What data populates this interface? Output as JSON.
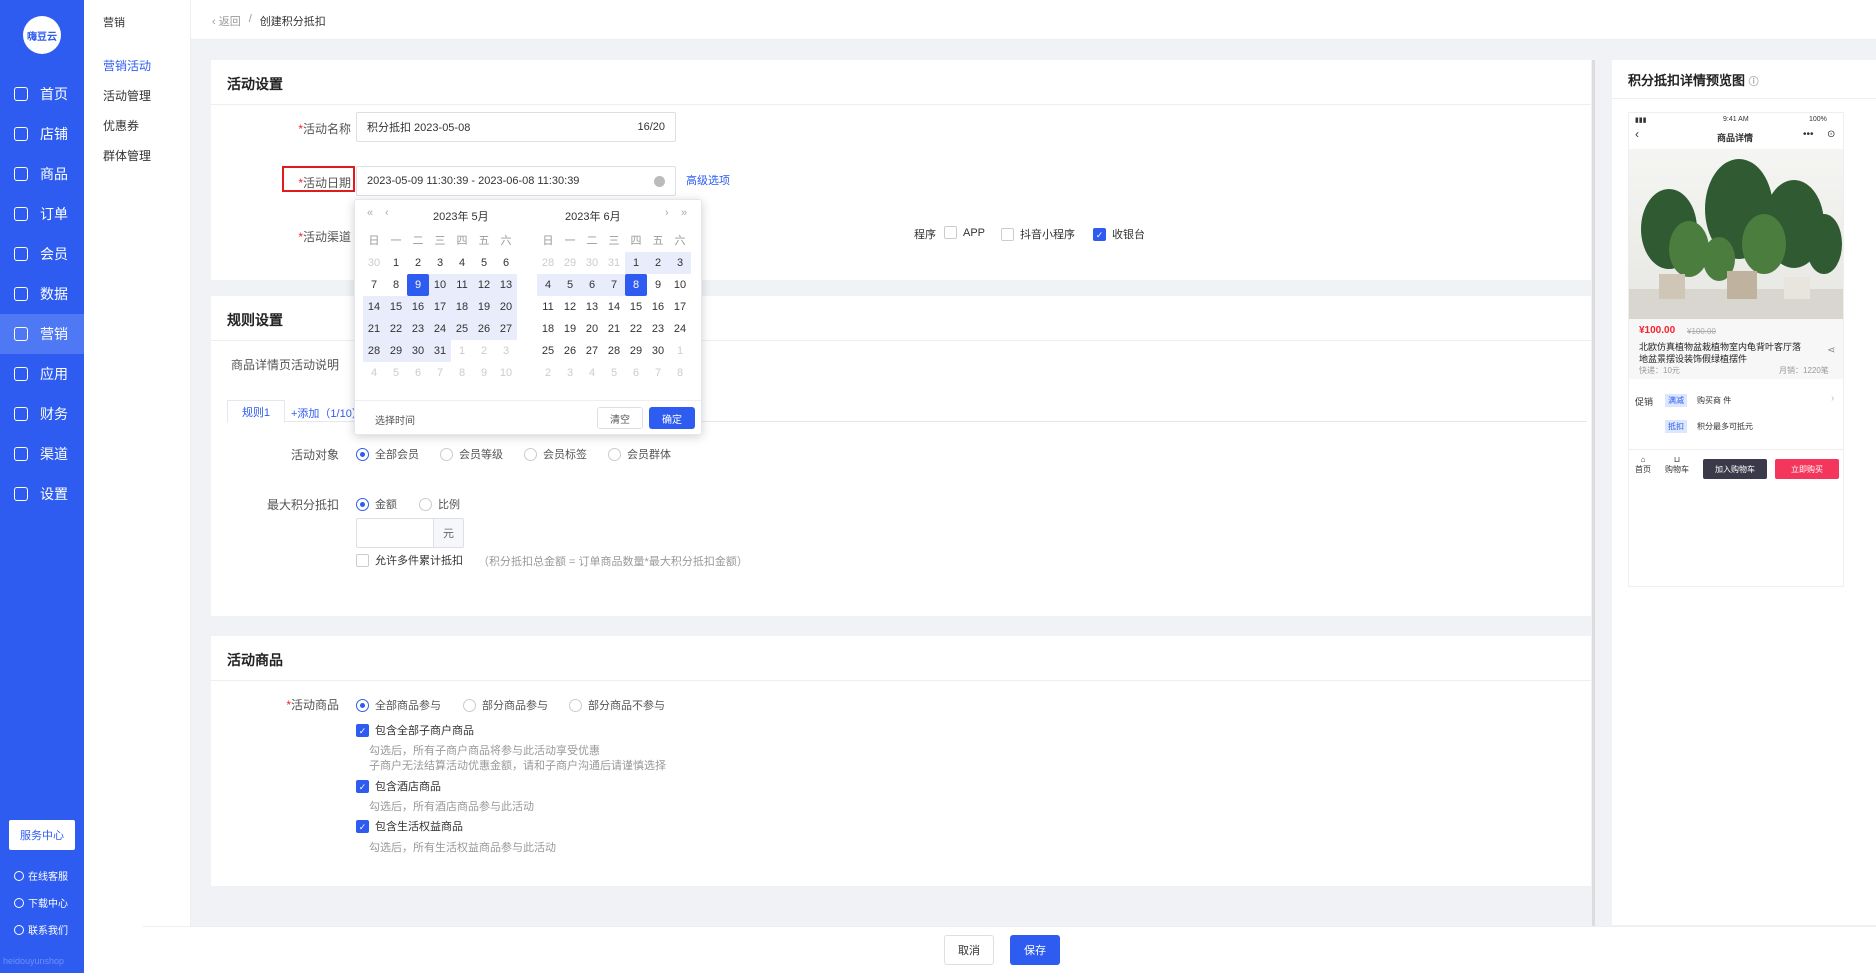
{
  "nav": {
    "logo": "嗨豆云",
    "items": [
      {
        "label": "首页",
        "icon": "home-icon"
      },
      {
        "label": "店铺",
        "icon": "store-icon"
      },
      {
        "label": "商品",
        "icon": "goods-icon"
      },
      {
        "label": "订单",
        "icon": "order-icon"
      },
      {
        "label": "会员",
        "icon": "member-icon"
      },
      {
        "label": "数据",
        "icon": "data-icon"
      },
      {
        "label": "营销",
        "icon": "tag-icon"
      },
      {
        "label": "应用",
        "icon": "app-icon"
      },
      {
        "label": "财务",
        "icon": "finance-icon"
      },
      {
        "label": "渠道",
        "icon": "channel-icon"
      },
      {
        "label": "设置",
        "icon": "gear-icon"
      }
    ],
    "service_center": "服务中心",
    "online_service": "在线客服",
    "download_center": "下载中心",
    "contact_us": "联系我们",
    "watermark": "heidouyunshop"
  },
  "subnav": {
    "title": "营销",
    "items": [
      "营销活动",
      "活动管理",
      "优惠券",
      "群体管理"
    ]
  },
  "breadcrumb": {
    "back": "返回",
    "sep": "/",
    "current": "创建积分抵扣"
  },
  "activity": {
    "title": "活动设置",
    "name_label": "活动名称",
    "name_value": "积分抵扣  2023-05-08",
    "name_count": "16/20",
    "date_label": "活动日期",
    "date_value": "2023-05-09 11:30:39 - 2023-06-08 11:30:39",
    "advanced": "高级选项",
    "channel_label": "活动渠道",
    "channels": [
      {
        "label": "程序",
        "checked": false
      },
      {
        "label": "APP",
        "checked": false
      },
      {
        "label": "抖音小程序",
        "checked": false
      },
      {
        "label": "收银台",
        "checked": true
      }
    ]
  },
  "calendar": {
    "left_title": "2023年 5月",
    "right_title": "2023年 6月",
    "weekdays": [
      "日",
      "一",
      "二",
      "三",
      "四",
      "五",
      "六"
    ],
    "select_time": "选择时间",
    "clear": "清空",
    "confirm": "确定",
    "left_days": [
      "30",
      "1",
      "2",
      "3",
      "4",
      "5",
      "6",
      "7",
      "8",
      "9",
      "10",
      "11",
      "12",
      "13",
      "14",
      "15",
      "16",
      "17",
      "18",
      "19",
      "20",
      "21",
      "22",
      "23",
      "24",
      "25",
      "26",
      "27",
      "28",
      "29",
      "30",
      "31",
      "1",
      "2",
      "3",
      "4",
      "5",
      "6",
      "7",
      "8",
      "9",
      "10"
    ],
    "right_days": [
      "28",
      "29",
      "30",
      "31",
      "1",
      "2",
      "3",
      "4",
      "5",
      "6",
      "7",
      "8",
      "9",
      "10",
      "11",
      "12",
      "13",
      "14",
      "15",
      "16",
      "17",
      "18",
      "19",
      "20",
      "21",
      "22",
      "23",
      "24",
      "25",
      "26",
      "27",
      "28",
      "29",
      "30",
      "1",
      "2",
      "3",
      "4",
      "5",
      "6",
      "7",
      "8"
    ]
  },
  "rules": {
    "title": "规则设置",
    "desc_label": "商品详情页活动说明",
    "tab1": "规则1",
    "tab_add": "+添加（1/10）",
    "target_label": "活动对象",
    "targets": [
      {
        "label": "全部会员",
        "on": true
      },
      {
        "label": "会员等级",
        "on": false
      },
      {
        "label": "会员标签",
        "on": false
      },
      {
        "label": "会员群体",
        "on": false
      }
    ],
    "max_label": "最大积分抵扣",
    "max_options": [
      {
        "label": "金额",
        "on": true
      },
      {
        "label": "比例",
        "on": false
      }
    ],
    "unit": "元",
    "multi_label": "允许多件累计抵扣",
    "multi_hint": "（积分抵扣总金额 = 订单商品数量*最大积分抵扣金额）"
  },
  "goods": {
    "title": "活动商品",
    "label": "活动商品",
    "options": [
      {
        "label": "全部商品参与",
        "on": true
      },
      {
        "label": "部分商品参与",
        "on": false
      },
      {
        "label": "部分商品不参与",
        "on": false
      }
    ],
    "c1": "包含全部子商户商品",
    "c1_hint1": "勾选后，所有子商户商品将参与此活动享受优惠",
    "c1_hint2": "子商户无法结算活动优惠金额，请和子商户沟通后请谨慎选择",
    "c2": "包含酒店商品",
    "c2_hint": "勾选后，所有酒店商品参与此活动",
    "c3": "包含生活权益商品",
    "c3_hint": "勾选后，所有生活权益商品参与此活动"
  },
  "preview": {
    "title": "积分抵扣详情预览图",
    "status_time": "9:41 AM",
    "status_battery": "100%",
    "page_title": "商品详情",
    "price": "¥100.00",
    "orig_price": "¥100.00",
    "product_name": "北欧仿真植物盆栽植物室内龟背叶客厅落地盆景摆设装饰假绿植摆件",
    "shipping": "快递：10元",
    "sales": "月销：1220笔",
    "promo_label": "促销",
    "promo_tag1": "满减",
    "promo_text1": "购买商 件",
    "promo_tag2": "抵扣",
    "promo_text2": "积分最多可抵元",
    "home": "首页",
    "cart": "购物车",
    "add_cart": "加入购物车",
    "buy_now": "立即购买"
  },
  "footer": {
    "cancel": "取消",
    "save": "保存"
  }
}
